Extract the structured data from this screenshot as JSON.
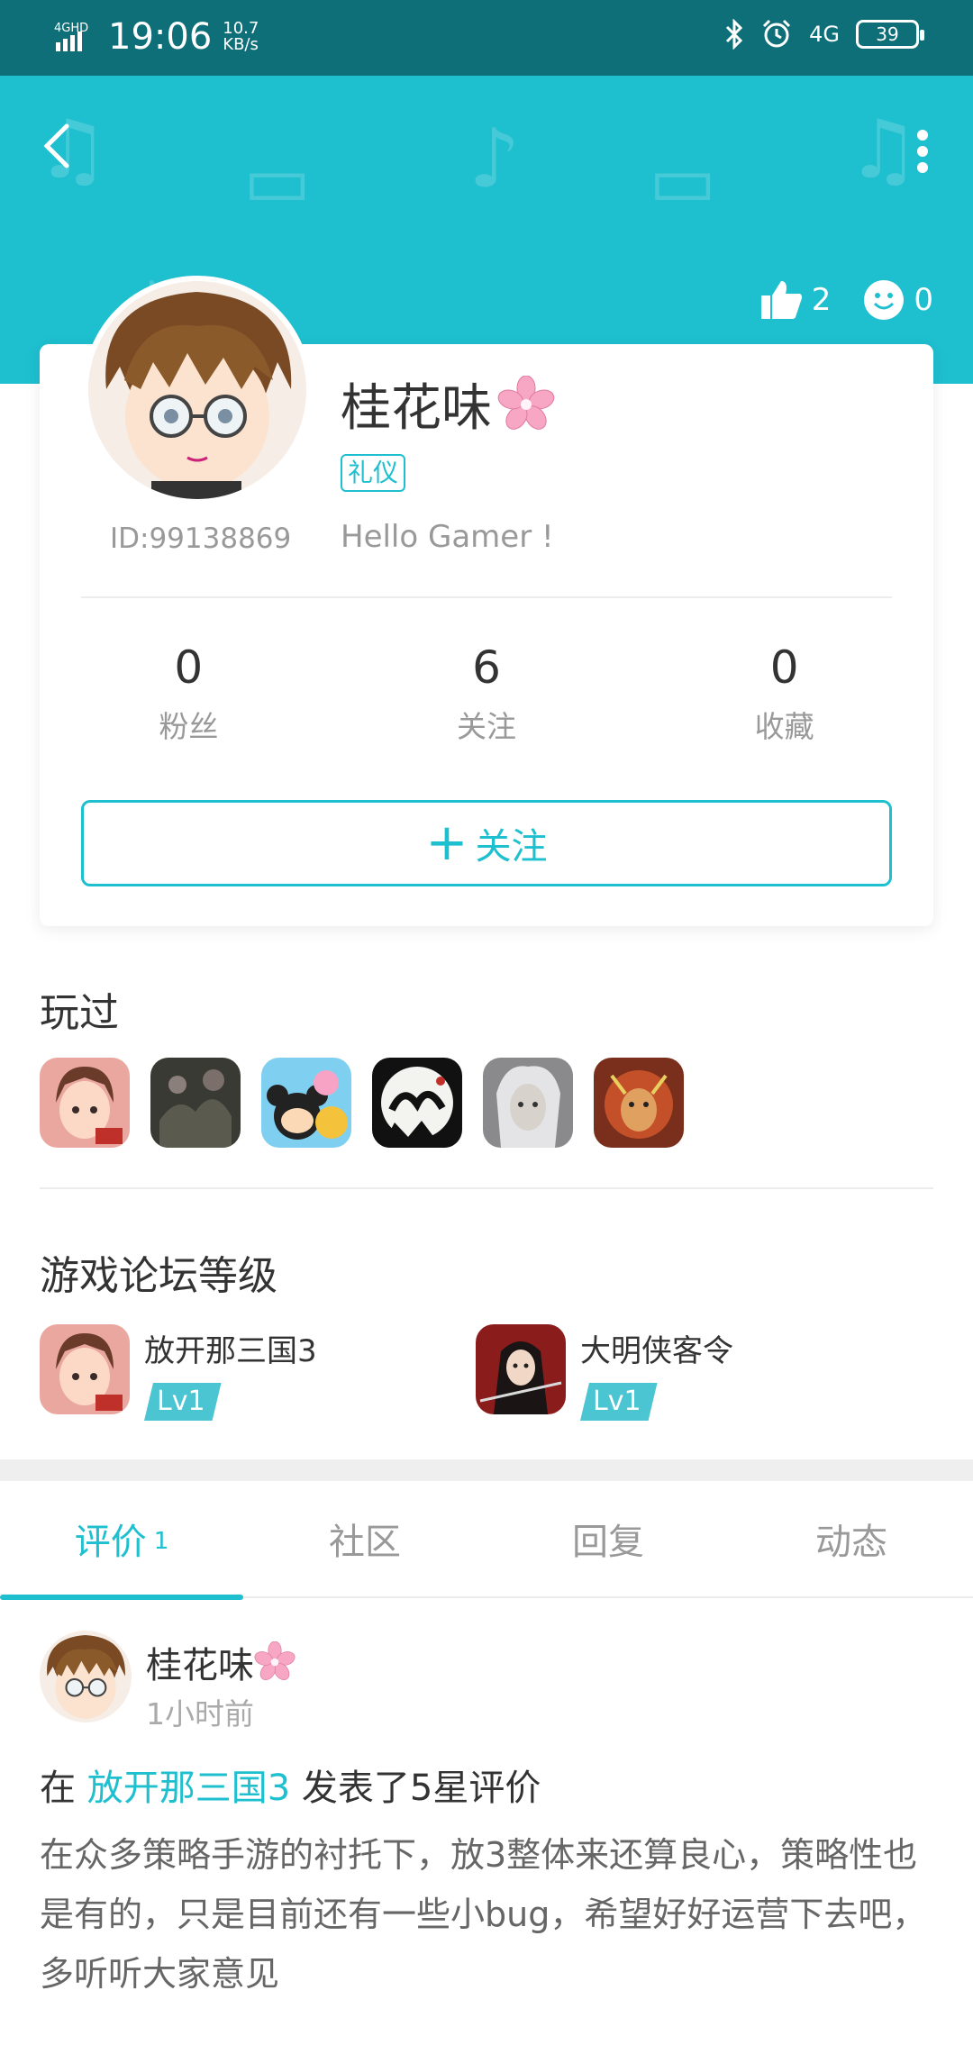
{
  "status_bar": {
    "network": "4GHD",
    "time": "19:06",
    "speed_value": "10.7",
    "speed_unit": "KB/s",
    "network_right": "4G",
    "battery": "39"
  },
  "header": {
    "likes": "2",
    "smiles": "0"
  },
  "profile": {
    "name": "桂花味",
    "tag": "礼仪",
    "bio": "Hello Gamer !",
    "id_text": "ID:99138869"
  },
  "stats": [
    {
      "value": "0",
      "label": "粉丝"
    },
    {
      "value": "6",
      "label": "关注"
    },
    {
      "value": "0",
      "label": "收藏"
    }
  ],
  "follow_button": {
    "plus": "+",
    "label": "关注"
  },
  "played": {
    "title": "玩过",
    "games": [
      "game-1",
      "game-2",
      "game-3",
      "game-4",
      "game-5",
      "game-6"
    ]
  },
  "levels": {
    "title": "游戏论坛等级",
    "items": [
      {
        "game": "放开那三国3",
        "level": "Lv1"
      },
      {
        "game": "大明侠客令",
        "level": "Lv1"
      }
    ]
  },
  "tabs": [
    {
      "label": "评价",
      "count": "1"
    },
    {
      "label": "社区",
      "count": ""
    },
    {
      "label": "回复",
      "count": ""
    },
    {
      "label": "动态",
      "count": ""
    }
  ],
  "review": {
    "author": "桂花味",
    "time": "1小时前",
    "prefix": "在 ",
    "game": "放开那三国3",
    "suffix": " 发表了5星评价",
    "body": "在众多策略手游的衬托下，放3整体来还算良心，策略性也是有的，只是目前还有一些小bug，希望好好运营下去吧，多听听大家意见"
  },
  "colors": {
    "accent": "#1ebfcf",
    "status_bar": "#0e6f78"
  }
}
